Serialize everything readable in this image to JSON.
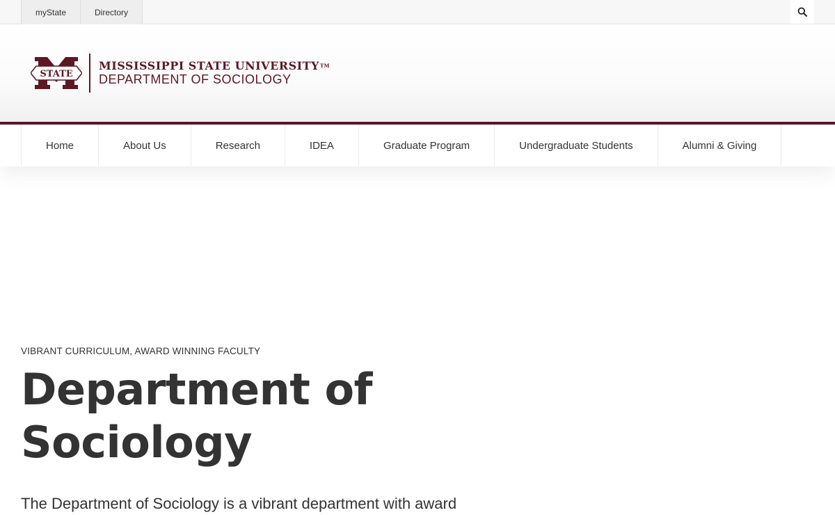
{
  "utility": {
    "links": [
      "myState",
      "Directory"
    ]
  },
  "brand": {
    "university": "MISSISSIPPI STATE UNIVERSITY",
    "tm": "TM",
    "department": "DEPARTMENT OF SOCIOLOGY",
    "seal_text": "STATE",
    "color": "#5d1725"
  },
  "nav": {
    "items": [
      "Home",
      "About Us",
      "Research",
      "IDEA",
      "Graduate Program",
      "Undergraduate Students",
      "Alumni & Giving"
    ]
  },
  "hero": {
    "eyebrow": "VIBRANT CURRICULUM, AWARD WINNING FACULTY",
    "title": "Department of Sociology",
    "intro": "The Department of Sociology is a vibrant department with award"
  },
  "icons": {
    "search": "search-icon"
  }
}
